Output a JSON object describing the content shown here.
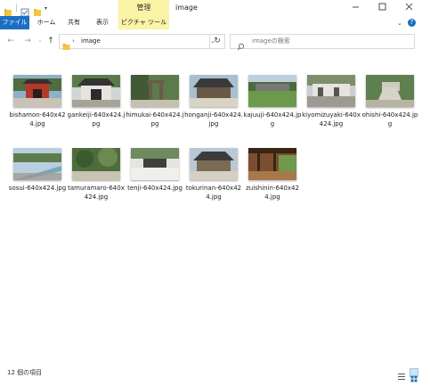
{
  "window": {
    "title": "image",
    "context_tab_group": "管理",
    "controls": [
      "minimize-icon",
      "maximize-icon",
      "close-icon"
    ]
  },
  "ribbon": {
    "tabs": [
      {
        "label": "ファイル"
      },
      {
        "label": "ホーム"
      },
      {
        "label": "共有"
      },
      {
        "label": "表示"
      },
      {
        "label": "ピクチャ ツール"
      }
    ],
    "icons": [
      "chevron-down-icon",
      "help-icon"
    ]
  },
  "address_bar": {
    "path": "image",
    "separator": "›",
    "search_placeholder": "imageの検索"
  },
  "files": [
    {
      "name": "bishamon-640x424.jpg"
    },
    {
      "name": "gankeiji-640x424.jpg"
    },
    {
      "name": "himukai-640x424.jpg"
    },
    {
      "name": "honganji-640x424.jpg"
    },
    {
      "name": "kajuuji-640x424.jpg"
    },
    {
      "name": "kiyomizuyaki-640x424.jpg"
    },
    {
      "name": "ohishi-640x424.jpg"
    },
    {
      "name": "sosui-640x424.jpg"
    },
    {
      "name": "tamuramaro-640x424.jpg"
    },
    {
      "name": "tenji-640x424.jpg"
    },
    {
      "name": "tokurinan-640x424.jpg"
    },
    {
      "name": "zuishinin-640x424.jpg"
    }
  ],
  "status": {
    "item_count": "12 個の項目"
  },
  "colors": {
    "file_tab": "#1a6fc2",
    "context_tab": "#fbf3a6",
    "selected_view": "#cce4f7"
  }
}
